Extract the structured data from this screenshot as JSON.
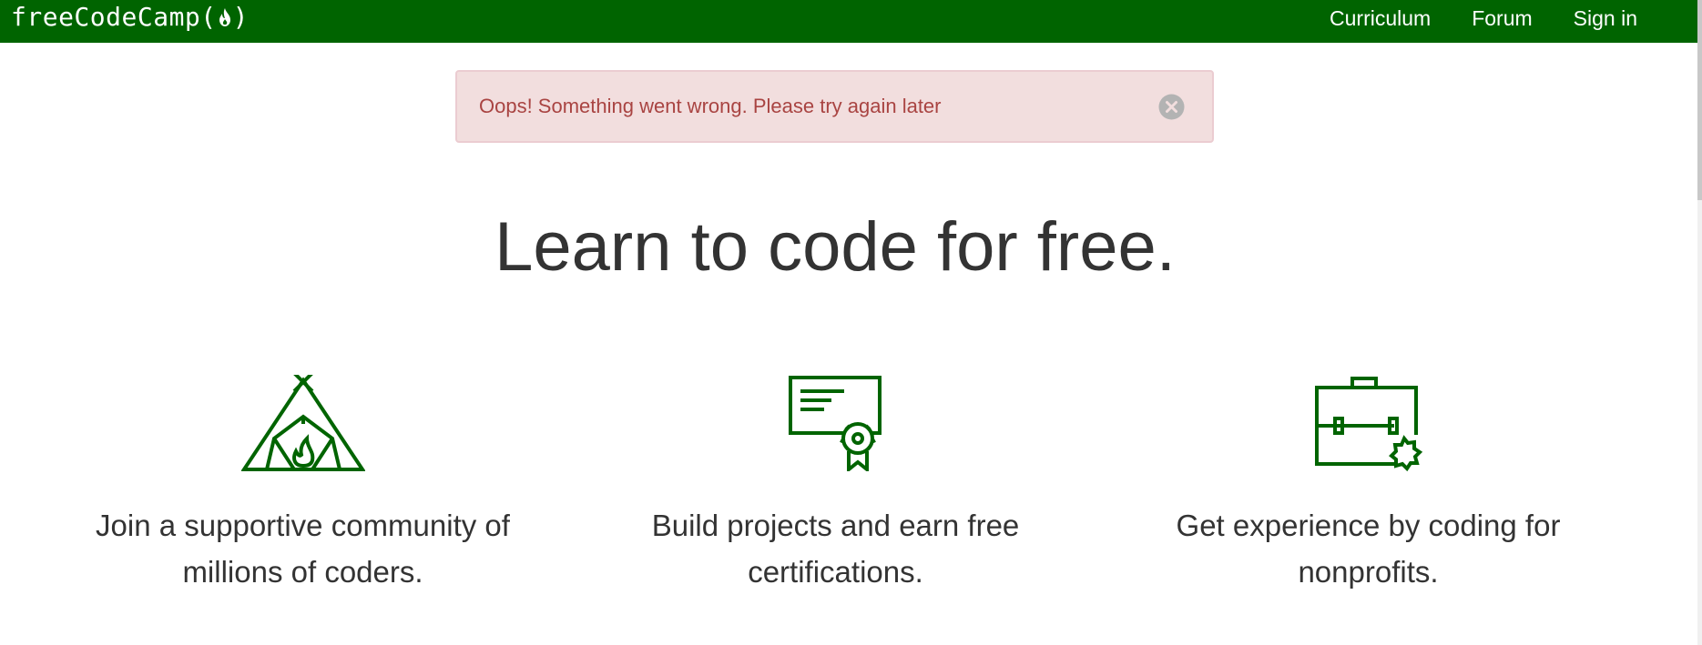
{
  "navbar": {
    "brand_text": "freeCodeCamp(",
    "brand_text_end": ")",
    "links": [
      {
        "label": "Curriculum"
      },
      {
        "label": "Forum"
      },
      {
        "label": "Sign in"
      }
    ],
    "background_color": "#006400"
  },
  "alert": {
    "message": "Oops! Something went wrong. Please try again later",
    "close_icon": "close-circle-icon",
    "background_color": "#f2dede",
    "text_color": "#a94442"
  },
  "hero": {
    "title": "Learn to code for free."
  },
  "features": [
    {
      "icon": "campfire-tent-icon",
      "text": "Join a supportive community of millions of coders."
    },
    {
      "icon": "certificate-icon",
      "text": "Build projects and earn free certifications."
    },
    {
      "icon": "briefcase-icon",
      "text": "Get experience by coding for nonprofits."
    }
  ]
}
